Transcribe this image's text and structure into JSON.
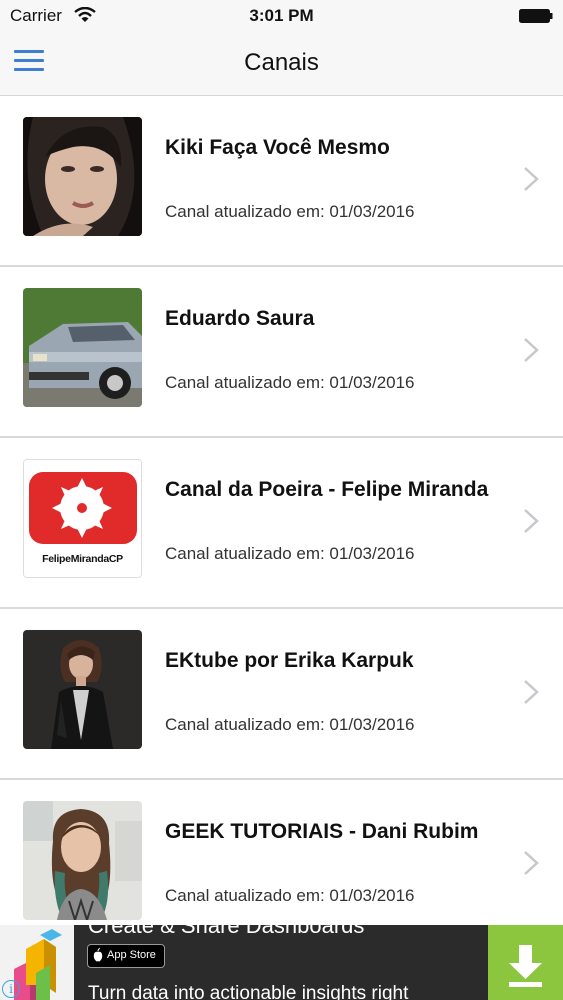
{
  "status_bar": {
    "carrier": "Carrier",
    "time": "3:01 PM",
    "icons": [
      "wifi-icon",
      "battery-icon"
    ]
  },
  "nav": {
    "title": "Canais",
    "menu_icon": "hamburger-menu-icon",
    "tint_color": "#3f7fd1"
  },
  "channels": [
    {
      "name": "Kiki Faça Você Mesmo",
      "updated": "Canal atualizado em: 01/03/2016",
      "thumb": "woman-portrait-photo"
    },
    {
      "name": "Eduardo Saura",
      "updated": "Canal atualizado em: 01/03/2016",
      "thumb": "car-photo"
    },
    {
      "name": "Canal da Poeira - Felipe Miranda",
      "updated": "Canal atualizado em: 01/03/2016",
      "thumb": "saw-blade-logo",
      "thumb_text": "FelipeMirandaCP"
    },
    {
      "name": "EKtube por Erika Karpuk",
      "updated": "Canal atualizado em: 01/03/2016",
      "thumb": "woman-portrait-photo"
    },
    {
      "name": "GEEK TUTORIAIS - Dani Rubim",
      "updated": "Canal atualizado em: 01/03/2016",
      "thumb": "woman-portrait-photo"
    }
  ],
  "ad": {
    "headline": "Create & Share Dashboards",
    "badge": "App Store",
    "subtext": "Turn data into actionable insights right",
    "accent_color": "#8cc63f",
    "icons": [
      "info-icon",
      "download-arrow-icon"
    ]
  }
}
